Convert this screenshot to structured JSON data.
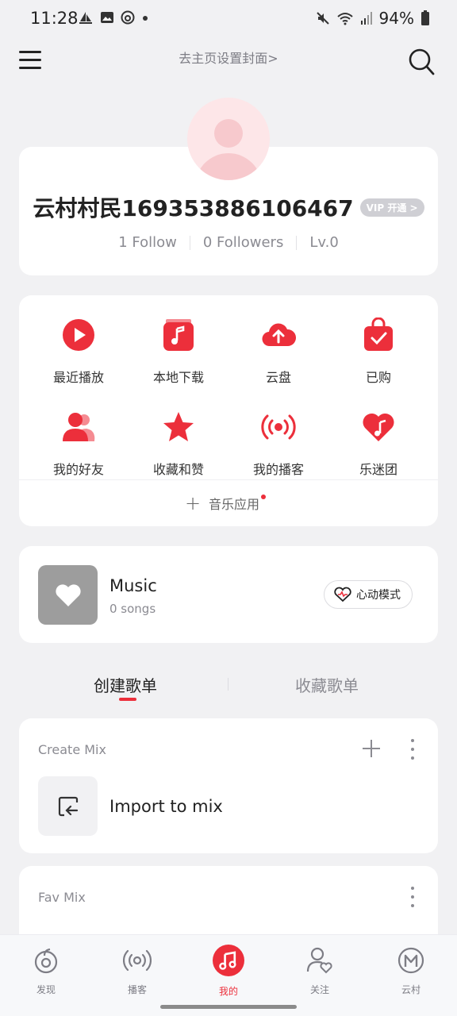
{
  "status_bar": {
    "time": "11:28",
    "battery": "94%"
  },
  "header": {
    "cover_link": "去主页设置封面>",
    "menu_icon": "hamburger-menu-icon",
    "search_icon": "search-icon"
  },
  "profile": {
    "username": "云村村民169353886106467",
    "vip_badge": "VIP 开通 >",
    "follow": "1 Follow",
    "followers": "0 Followers",
    "level": "Lv.0"
  },
  "features": [
    {
      "label": "最近播放",
      "icon": "play-circle-icon"
    },
    {
      "label": "本地下载",
      "icon": "music-note-box-icon"
    },
    {
      "label": "云盘",
      "icon": "cloud-upload-icon"
    },
    {
      "label": "已购",
      "icon": "shopping-bag-icon"
    },
    {
      "label": "我的好友",
      "icon": "friends-icon"
    },
    {
      "label": "收藏和赞",
      "icon": "star-icon"
    },
    {
      "label": "我的播客",
      "icon": "broadcast-icon"
    },
    {
      "label": "乐迷团",
      "icon": "heart-music-icon"
    }
  ],
  "music_apps": {
    "label": "音乐应用"
  },
  "liked": {
    "title": "Music",
    "count": "0 songs",
    "heart_mode": "心动模式"
  },
  "tabs": {
    "created": "创建歌单",
    "collected": "收藏歌单"
  },
  "create_mix": {
    "header": "Create Mix",
    "import_label": "Import to mix"
  },
  "fav_mix": {
    "header": "Fav Mix"
  },
  "bottom_nav": [
    {
      "label": "发现",
      "icon": "discover-icon",
      "active": false
    },
    {
      "label": "播客",
      "icon": "podcast-icon",
      "active": false
    },
    {
      "label": "我的",
      "icon": "my-music-icon",
      "active": true
    },
    {
      "label": "关注",
      "icon": "follow-icon",
      "active": false
    },
    {
      "label": "云村",
      "icon": "village-icon",
      "active": false
    }
  ],
  "colors": {
    "accent": "#ec2f3b",
    "background": "#f1f1f3"
  }
}
